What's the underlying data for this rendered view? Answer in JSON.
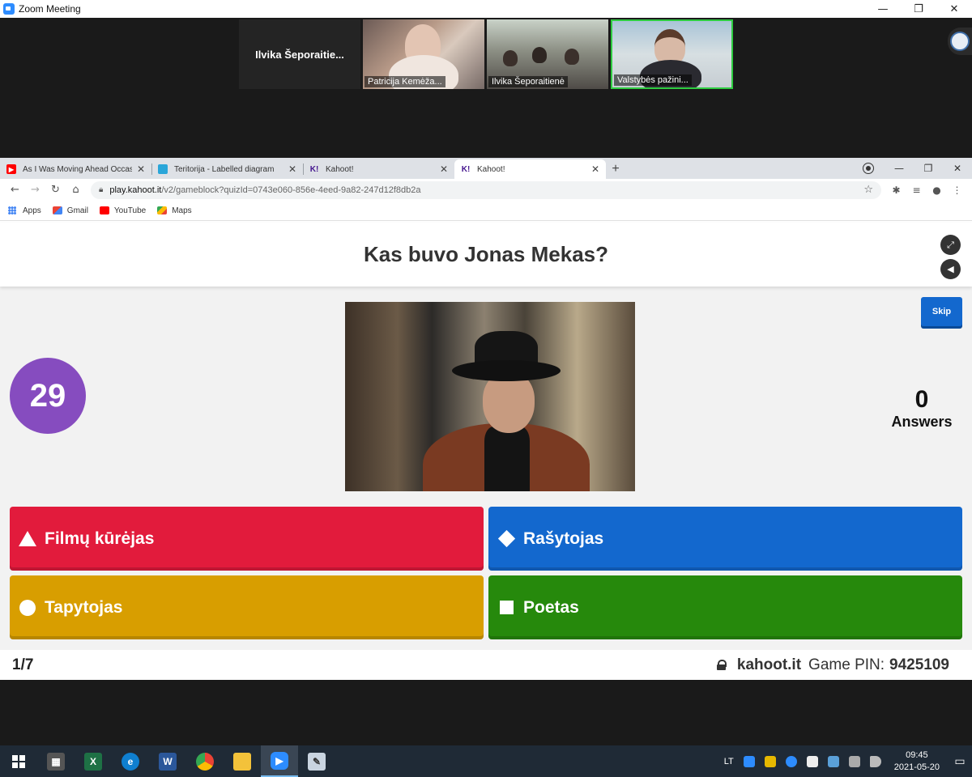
{
  "zoom": {
    "title": "Zoom Meeting",
    "participants": [
      {
        "name": "Ilvika  Šeporaitie..."
      },
      {
        "name": "Patricija Kemėža..."
      },
      {
        "name": "Ilvika Šeporaitienė"
      },
      {
        "name": "Valstybės pažini..."
      }
    ]
  },
  "window_controls": {
    "minimize": "—",
    "restore": "❐",
    "close": "✕"
  },
  "browser": {
    "tabs": [
      {
        "title": "As I Was Moving Ahead Occasional",
        "favicon": "youtube-icon"
      },
      {
        "title": "Teritorija - Labelled diagram",
        "favicon": "wordwall-icon"
      },
      {
        "title": "Kahoot!",
        "favicon": "kahoot-icon"
      },
      {
        "title": "Kahoot!",
        "favicon": "kahoot-icon"
      }
    ],
    "url_host": "play.kahoot.it",
    "url_path": "/v2/gameblock?quizId=0743e060-856e-4eed-9a82-247d12f8db2a",
    "bookmarks": [
      {
        "label": "Apps"
      },
      {
        "label": "Gmail"
      },
      {
        "label": "YouTube"
      },
      {
        "label": "Maps"
      }
    ]
  },
  "kahoot": {
    "question": "Kas buvo Jonas Mekas?",
    "timer": "29",
    "skip_label": "Skip",
    "answers_count": "0",
    "answers_label": "Answers",
    "options": [
      {
        "shape": "triangle",
        "label": "Filmų kūrėjas",
        "color": "#e21b3c"
      },
      {
        "shape": "diamond",
        "label": "Rašytojas",
        "color": "#1368ce"
      },
      {
        "shape": "circle",
        "label": "Tapytojas",
        "color": "#d89e00"
      },
      {
        "shape": "square",
        "label": "Poetas",
        "color": "#26890c"
      }
    ],
    "progress": "1/7",
    "brand": "kahoot.it",
    "pin_label": "Game PIN:",
    "pin": "9425109"
  },
  "taskbar": {
    "language": "LT",
    "time": "09:45",
    "date": "2021-05-20"
  }
}
